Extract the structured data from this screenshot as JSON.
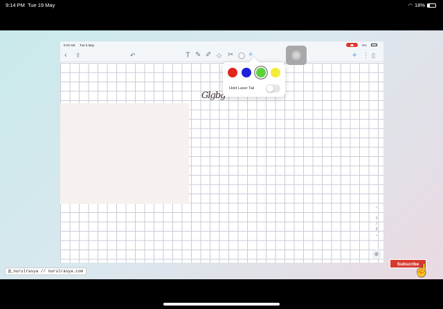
{
  "ipad_status": {
    "time": "9:14 PM",
    "date": "Tue 19 May",
    "battery": "18%"
  },
  "inner_status": {
    "time": "9:23 AM",
    "date": "Tue 5 May",
    "battery": "4%"
  },
  "toolbar": {
    "left_icons": [
      "back-icon",
      "share-icon",
      "undo-icon"
    ],
    "tools": [
      "text-tool-icon",
      "pencil-icon",
      "highlighter-icon",
      "eraser-icon",
      "lasso-icon",
      "shapes-icon",
      "laser-pointer-icon"
    ],
    "right_icons": [
      "add-icon",
      "more-icon",
      "pages-icon"
    ]
  },
  "canvas": {
    "handwriting": "Glgbg"
  },
  "laser_popover": {
    "colors": [
      "#e0261e",
      "#1f1fd9",
      "#5bd13a",
      "#f2ec3a"
    ],
    "selected_color": "#5bd13a",
    "hold_laser_tail_label": "Hold Laser Tail",
    "hold_laser_tail_on": false
  },
  "page_scroller": {
    "current": "1",
    "total": "2"
  },
  "watermark": "@_nurulrasya // nurulrasya.com",
  "subscribe_label": "Subscribe"
}
